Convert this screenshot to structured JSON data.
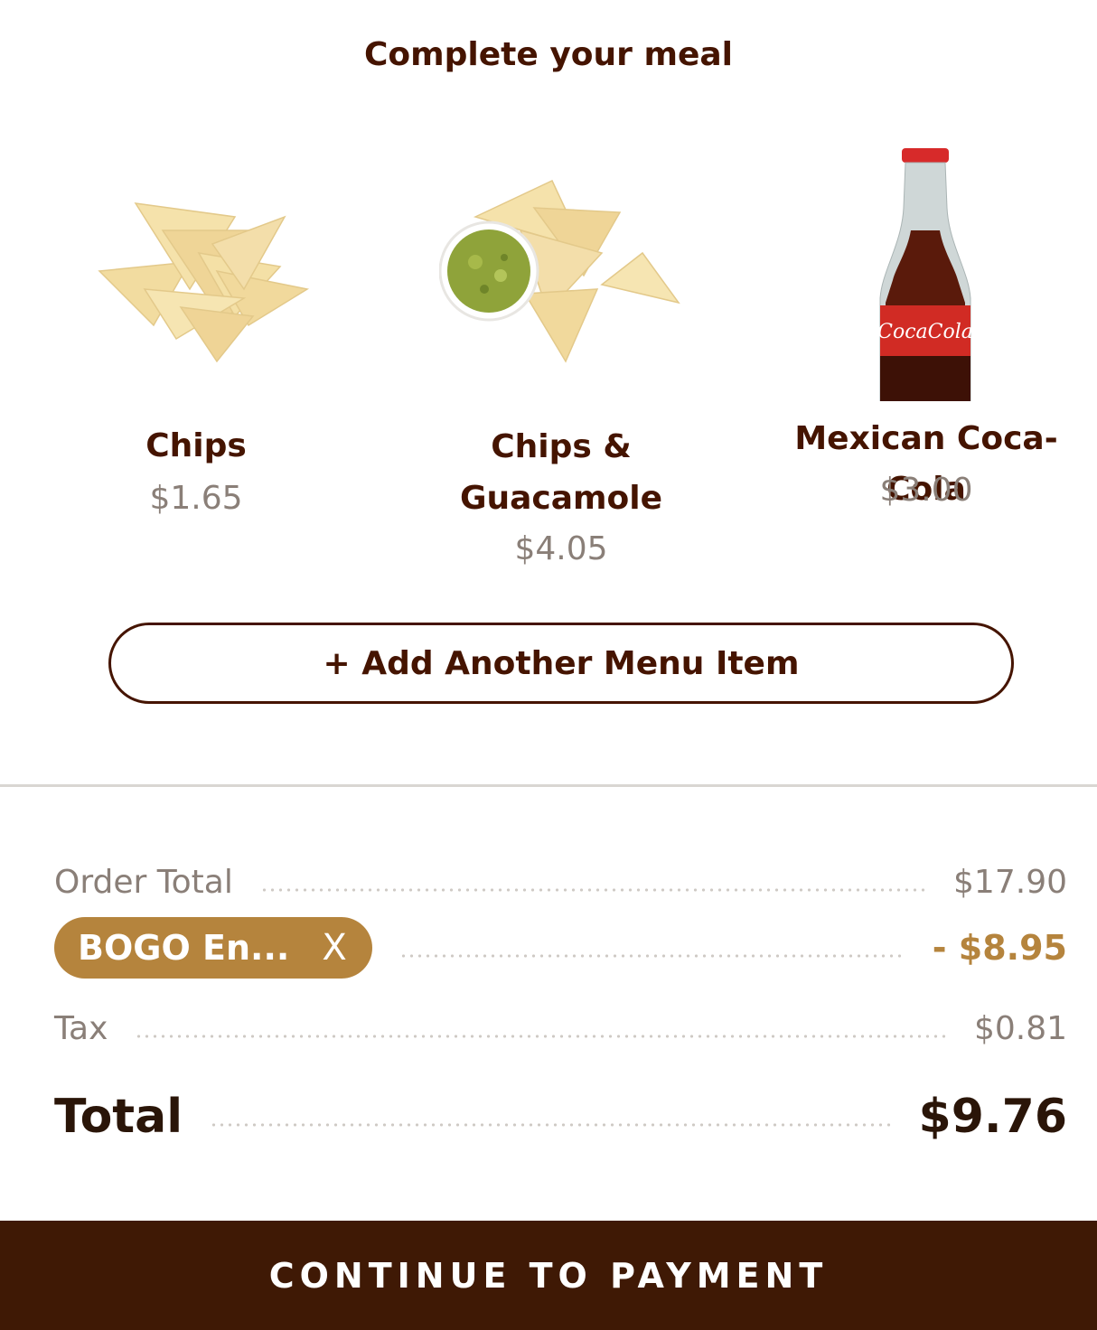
{
  "page": {
    "title": "Complete your meal"
  },
  "upsell": {
    "items": [
      {
        "name": "Chips",
        "price": "$1.65",
        "image": "chips"
      },
      {
        "name_line1": "Chips &",
        "name_line2": "Guacamole",
        "price": "$4.05",
        "image": "chips-and-guacamole"
      },
      {
        "name": "Mexican Coca-Cola",
        "price": "$3.00",
        "image": "coca-cola-bottle"
      }
    ]
  },
  "actions": {
    "add_item_label": "+ Add Another Menu Item"
  },
  "summary": {
    "order_total_label": "Order Total",
    "order_total_value": "$17.90",
    "promo_code": "BOGO En...",
    "promo_remove": "X",
    "promo_value": "- $8.95",
    "tax_label": "Tax",
    "tax_value": "$0.81",
    "total_label": "Total",
    "total_value": "$9.76"
  },
  "footer": {
    "cta_label": "CONTINUE TO PAYMENT"
  },
  "colors": {
    "brand_brown": "#451400",
    "promo_gold": "#b5843d",
    "muted_text": "#8a7f78",
    "cta_background": "#3f1905"
  }
}
